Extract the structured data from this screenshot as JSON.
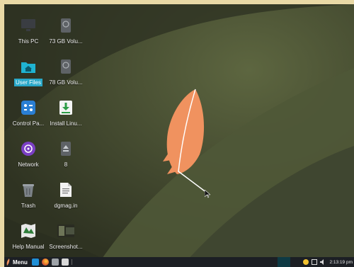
{
  "desktop": {
    "icons": [
      {
        "label": "This PC",
        "icon": "monitor-icon"
      },
      {
        "label": "73 GB Volu...",
        "icon": "drive-icon"
      },
      {
        "label": "User Files",
        "icon": "home-folder-icon",
        "selected": true
      },
      {
        "label": "78 GB Volu...",
        "icon": "drive-icon"
      },
      {
        "label": "Control Pa...",
        "icon": "control-panel-icon"
      },
      {
        "label": "Install Linu...",
        "icon": "install-icon"
      },
      {
        "label": "Network",
        "icon": "network-icon"
      },
      {
        "label": "8",
        "icon": "eject-drive-icon"
      },
      {
        "label": "Trash",
        "icon": "trash-icon"
      },
      {
        "label": "dgmag.in",
        "icon": "text-file-icon"
      },
      {
        "label": "Help Manual",
        "icon": "map-book-icon"
      },
      {
        "label": "Screenshot...",
        "icon": "image-thumbnail-icon"
      }
    ]
  },
  "taskbar": {
    "menu_label": "Menu",
    "launchers": [
      "show-desktop-icon",
      "firefox-icon",
      "file-manager-icon",
      "terminal-icon"
    ],
    "clock": "2:13:19 pm"
  },
  "colors": {
    "accent": "#29a8c9",
    "feather": "#f0925f",
    "taskbar": "#1c1f24"
  }
}
